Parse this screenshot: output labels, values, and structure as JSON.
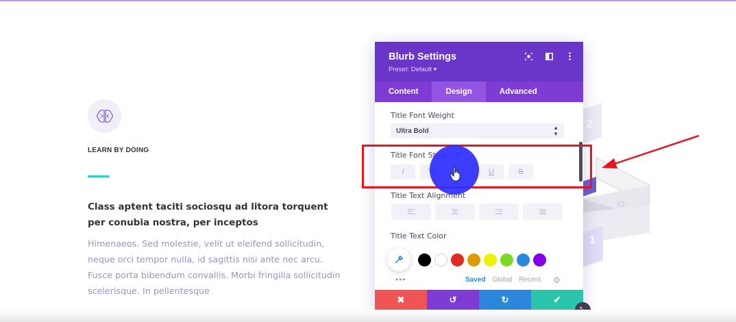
{
  "page": {
    "blurb_heading": "LEARN BY DOING",
    "lead_text": "Class aptent taciti sociosqu ad litora torquent per conubia nostra, per inceptos",
    "body_text": "Himenaeos. Sed molestie, velit ut eleifend sollicitudin, neque orci tempor nulla, id sagittis nisi ante nec arcu. Fusce porta bibendum convallis. Morbi fringilla sollicitudin scelerisque. In pellentesque",
    "illustration_numbers": [
      "2",
      "1"
    ]
  },
  "modal": {
    "title": "Blurb Settings",
    "preset": "Preset: Default ▾",
    "header_icons": [
      "focus-icon",
      "split-view-icon",
      "more-vertical-icon"
    ],
    "tabs": [
      {
        "label": "Content",
        "active": false
      },
      {
        "label": "Design",
        "active": true
      },
      {
        "label": "Advanced",
        "active": false
      }
    ],
    "font_weight": {
      "label": "Title Font Weight",
      "value": "Ultra Bold"
    },
    "font_style": {
      "label": "Title Font Style",
      "buttons": [
        "I",
        "TT",
        "Tт",
        "U",
        "S"
      ]
    },
    "alignment": {
      "label": "Title Text Alignment"
    },
    "text_color": {
      "label": "Title Text Color",
      "swatches": [
        "#000000",
        "#ffffff",
        "#e02b20",
        "#e09900",
        "#edf000",
        "#7cda24",
        "#2b87da",
        "#8300e9"
      ],
      "palette_tabs": [
        "Saved",
        "Global",
        "Recent"
      ],
      "active_palette_tab": "Saved"
    },
    "footer_colors": [
      "#ef5555",
      "#7e3bd3",
      "#2b87da",
      "#29c4a9"
    ]
  },
  "colors": {
    "accent": "#6a36c9",
    "annotation": "#e8141e",
    "cursor_highlight": "#2e2eff"
  }
}
